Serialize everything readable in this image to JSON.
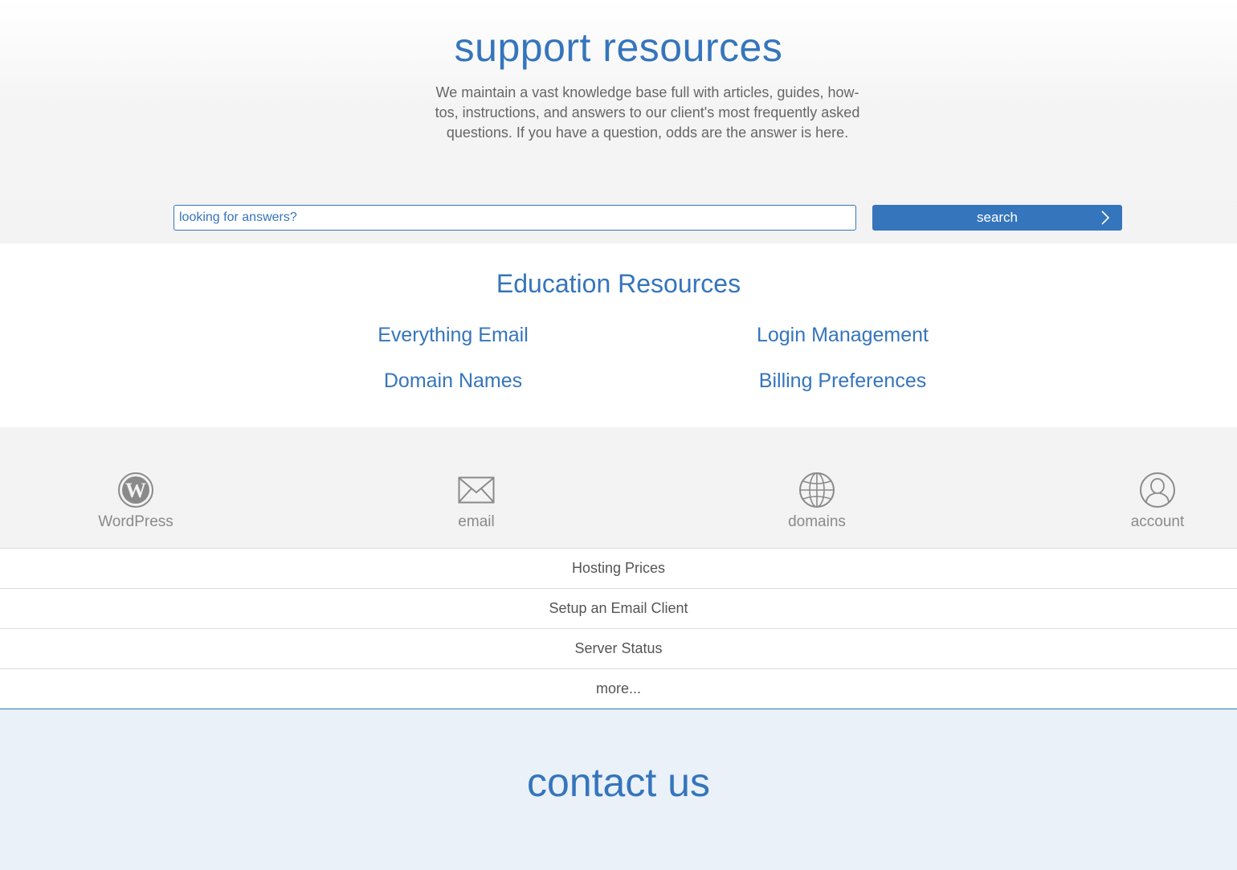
{
  "hero": {
    "title": "support resources",
    "description": "We maintain a vast knowledge base full with articles, guides, how-tos, instructions, and answers to our client's most frequently asked questions. If you have a question, odds are the answer is here.",
    "search_placeholder": "looking for answers?",
    "search_label": "search"
  },
  "education": {
    "title": "Education Resources",
    "links": [
      "Everything Email",
      "Login Management",
      "Domain Names",
      "Billing Preferences"
    ]
  },
  "categories": [
    {
      "label": "WordPress",
      "icon": "wordpress-icon"
    },
    {
      "label": "email",
      "icon": "envelope-icon"
    },
    {
      "label": "domains",
      "icon": "globe-icon"
    },
    {
      "label": "account",
      "icon": "user-icon"
    }
  ],
  "quick_links": [
    "Hosting Prices",
    "Setup an Email Client",
    "Server Status",
    "more..."
  ],
  "contact": {
    "title": "contact us"
  },
  "colors": {
    "accent": "#3575bc",
    "muted_icon": "#8a8a8a",
    "contact_bg": "#eaf1f9"
  }
}
